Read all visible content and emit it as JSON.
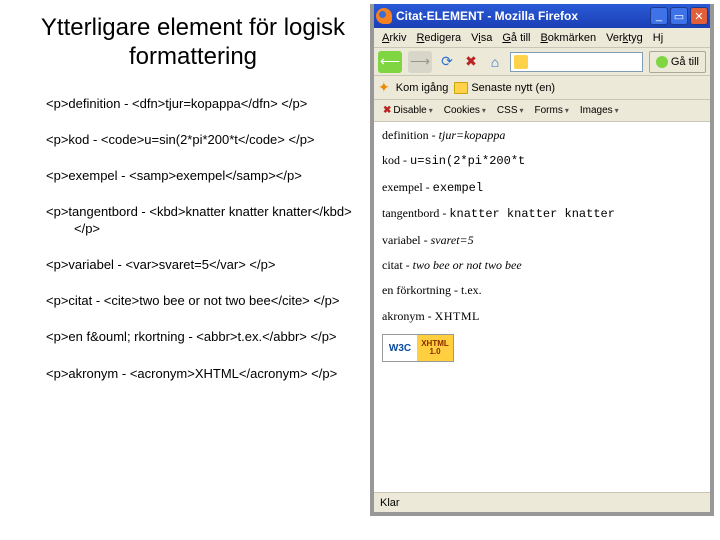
{
  "slide": {
    "title": "Ytterligare element för logisk formattering",
    "lines": [
      "<p>definition - <dfn>tjur=kopappa</dfn> </p>",
      "<p>kod - <code>u=sin(2*pi*200*t</code> </p>",
      "<p>exempel - <samp>exempel</samp></p>",
      "<p>tangentbord - <kbd>knatter knatter knatter</kbd> </p>",
      "<p>variabel - <var>svaret=5</var> </p>",
      "<p>citat - <cite>two bee or not two bee</cite> </p>",
      "<p>en f&ouml; rkortning - <abbr>t.ex.</abbr> </p>",
      "<p>akronym - <acronym>XHTML</acronym> </p>"
    ]
  },
  "browser": {
    "title": "Citat-ELEMENT - Mozilla Firefox",
    "menu": [
      "Arkiv",
      "Redigera",
      "Visa",
      "Gå till",
      "Bokmärken",
      "Verktyg",
      "Hj"
    ],
    "menu_underline_idx": [
      0,
      0,
      1,
      0,
      0,
      3,
      1
    ],
    "go_label": "Gå till",
    "bookmark1": "Kom igång",
    "bookmark2": "Senaste nytt (en)",
    "devbar": [
      "Disable",
      "Cookies",
      "CSS",
      "Forms",
      "Images"
    ],
    "status": "Klar",
    "w3c_left": "W3C",
    "w3c_right_top": "XHTML",
    "w3c_right_bot": "1.0"
  },
  "rendered": {
    "p1_a": "definition - ",
    "p1_b": "tjur=kopappa",
    "p2_a": "kod - ",
    "p2_b": "u=sin(2*pi*200*t",
    "p3_a": "exempel - ",
    "p3_b": "exempel",
    "p4_a": "tangentbord - ",
    "p4_b": "knatter knatter knatter",
    "p5_a": "variabel - ",
    "p5_b": "svaret=5",
    "p6_a": "citat - ",
    "p6_b": "two bee or not two bee",
    "p7_a": "en förkortning - ",
    "p7_b": "t.ex.",
    "p8_a": "akronym - ",
    "p8_b": "XHTML"
  }
}
